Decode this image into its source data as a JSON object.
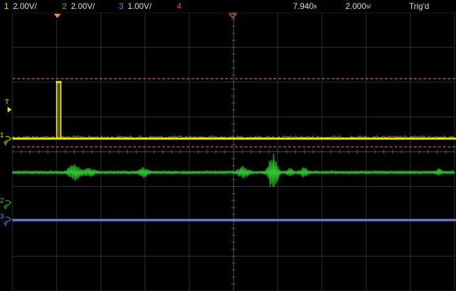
{
  "channels": [
    {
      "num": "1",
      "scale": "2.00V/",
      "color": "#e8e800"
    },
    {
      "num": "2",
      "scale": "2.00V/",
      "color": "#33cc33"
    },
    {
      "num": "3",
      "scale": "1.00V/",
      "color": "#6a7fff"
    },
    {
      "num": "4",
      "scale": "",
      "color": "#ff3377"
    }
  ],
  "horizontal": {
    "delay_value": "7.940",
    "delay_unit": "s",
    "timebase_value": "2.000",
    "timebase_unit": "s/"
  },
  "trigger": {
    "status": "Trig'd",
    "marker_label": "T",
    "cursor_color": "#ff8a30"
  },
  "ground_markers": [
    {
      "label": "1",
      "color": "#e8e800"
    },
    {
      "label": "2",
      "color": "#33cc33"
    },
    {
      "label": "3",
      "color": "#6a7fff"
    }
  ]
}
